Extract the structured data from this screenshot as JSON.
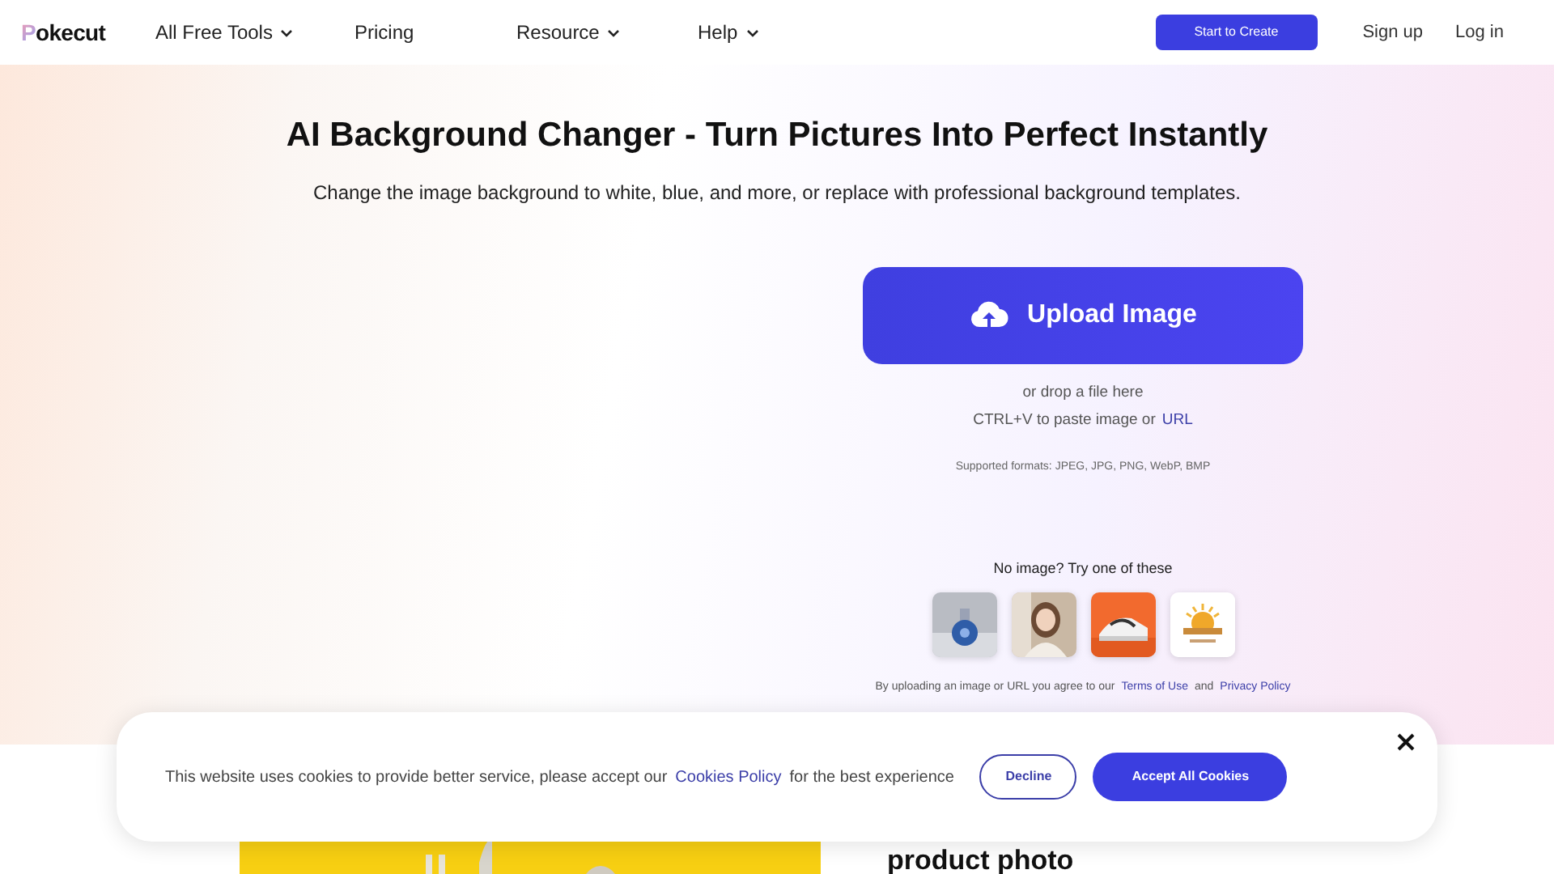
{
  "nav": {
    "logo": "Pokecut",
    "items": [
      {
        "label": "All Free Tools",
        "dropdown": true
      },
      {
        "label": "Pricing",
        "dropdown": false
      },
      {
        "label": "Resource",
        "dropdown": true
      },
      {
        "label": "Help",
        "dropdown": true
      }
    ],
    "cta": "Start to Create",
    "signup": "Sign up",
    "login": "Log in"
  },
  "hero": {
    "title": "AI Background Changer - Turn Pictures Into Perfect Instantly",
    "subtitle": "Change the image background to white, blue, and more, or replace with professional background templates.",
    "upload_button": "Upload Image",
    "drop_hint": "or drop a file here",
    "paste_hint": "CTRL+V to paste image or",
    "url_link": "URL",
    "formats": "Supported formats: JPEG, JPG, PNG, WebP, BMP",
    "samples_title": "No image? Try one of these",
    "terms_text": "By uploading an image or URL you agree to our",
    "terms_link": "Terms of Use",
    "and": "and",
    "privacy_link": "Privacy Policy"
  },
  "section": {
    "heading": "product photo"
  },
  "cookie_banner": {
    "text": "This website uses cookies to provide better service, please accept our",
    "policy_link": "Cookies Policy",
    "text_after": "for the best experience",
    "decline": "Decline",
    "accept": "Accept All Cookies"
  }
}
